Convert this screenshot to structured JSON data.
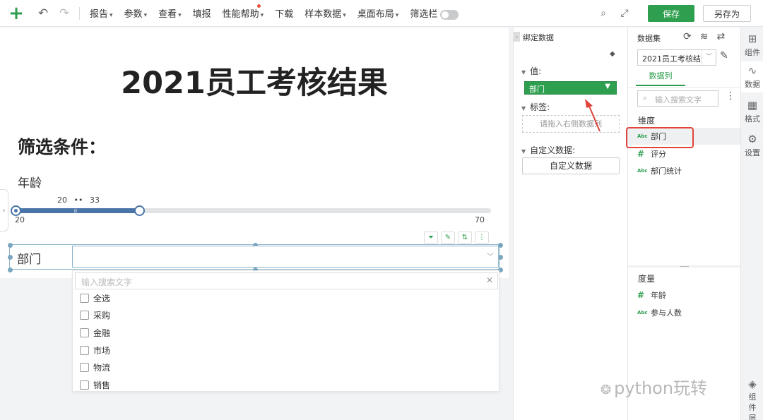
{
  "toolbar": {
    "menus": [
      {
        "label": "报告",
        "caret": true
      },
      {
        "label": "参数",
        "caret": true
      },
      {
        "label": "查看",
        "caret": true
      },
      {
        "label": "填报",
        "caret": false
      },
      {
        "label": "性能帮助",
        "caret": true,
        "dot": true
      },
      {
        "label": "下载",
        "caret": false
      },
      {
        "label": "样本数据",
        "caret": true
      },
      {
        "label": "桌面布局",
        "caret": true
      },
      {
        "label": "筛选栏",
        "caret": false,
        "toggle": true
      }
    ],
    "save_label": "保存",
    "save_as_label": "另存为"
  },
  "report": {
    "title": "2021员工考核结果",
    "filter_heading": "筛选条件：",
    "age_filter": {
      "label": "年龄",
      "min": 20,
      "max": 70,
      "low": 20,
      "high": 33,
      "readout_low": "20",
      "readout_sep": "••",
      "readout_high": "33",
      "min_label": "20",
      "max_label": "70"
    },
    "dept_filter": {
      "label": "部门",
      "search_placeholder": "输入搜索文字",
      "options": [
        "全选",
        "采购",
        "金融",
        "市场",
        "物流",
        "销售"
      ]
    }
  },
  "binding": {
    "title": "绑定数据",
    "value_section": "值:",
    "value_chip": "部门",
    "label_section": "标签:",
    "label_placeholder": "请拖入右侧数据列",
    "custom_section": "自定义数据:",
    "custom_button": "自定义数据"
  },
  "dataset": {
    "title": "数据集",
    "selected": "2021员工考核结",
    "tab": "数据列",
    "search_placeholder": "输入搜索文字",
    "dimension_heading": "维度",
    "dimensions": [
      {
        "name": "部门",
        "type": "Abc"
      },
      {
        "name": "评分",
        "type": "#"
      },
      {
        "name": "部门统计",
        "type": "Abc"
      }
    ],
    "measure_heading": "度量",
    "measures": [
      {
        "name": "年龄",
        "type": "#"
      },
      {
        "name": "参与人数",
        "type": "Abc"
      }
    ]
  },
  "side_tabs": [
    {
      "label": "组件",
      "icon": "component-icon"
    },
    {
      "label": "数据",
      "icon": "data-icon",
      "active": true
    },
    {
      "label": "格式",
      "icon": "format-icon"
    },
    {
      "label": "设置",
      "icon": "settings-icon"
    },
    {
      "label": "组件层",
      "icon": "layers-icon"
    }
  ],
  "watermark": "python玩转",
  "colors": {
    "accent": "#2e9e4f",
    "slider": "#4a74a8",
    "highlight": "#e0443a"
  }
}
